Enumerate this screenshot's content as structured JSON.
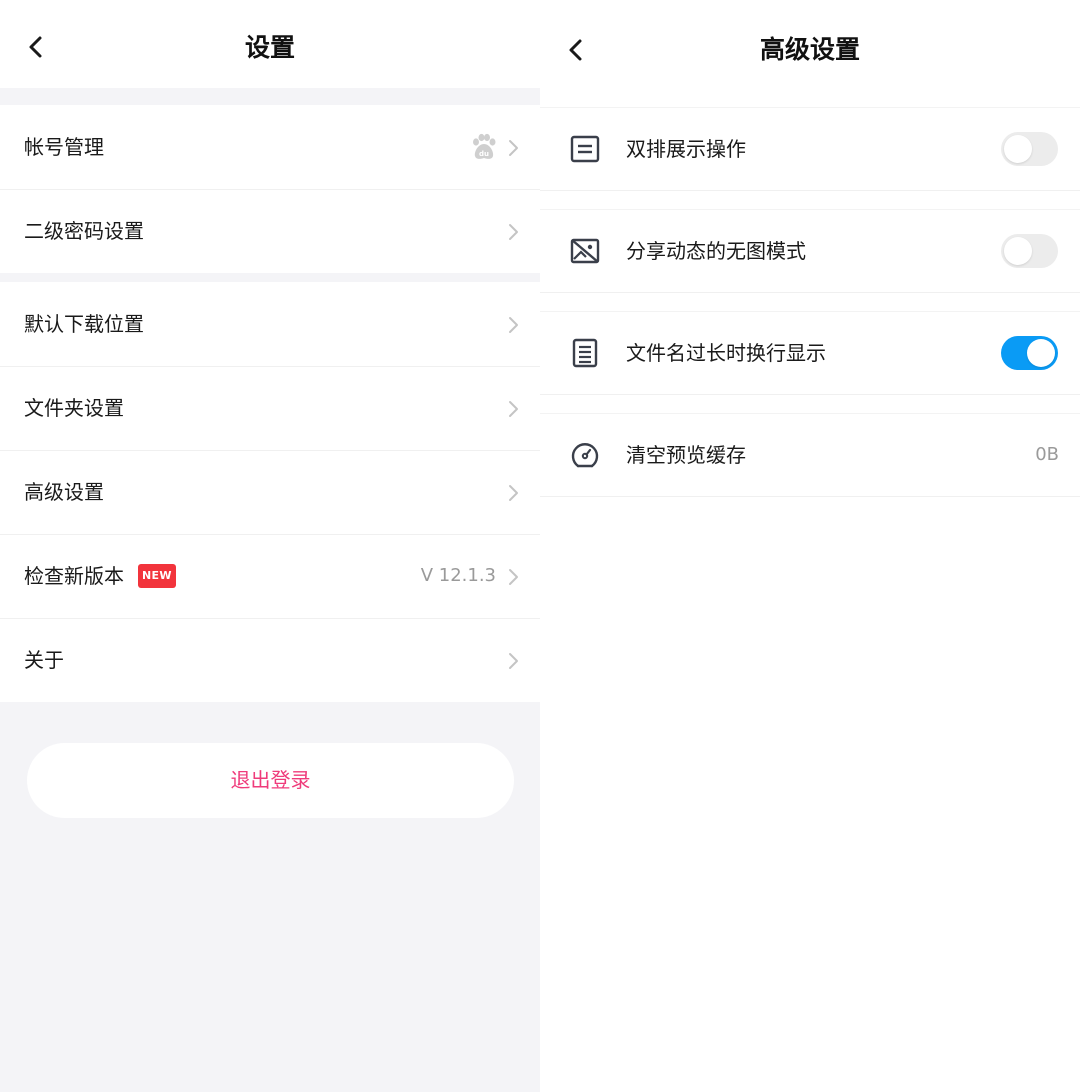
{
  "settings": {
    "title": "设置",
    "groups": [
      [
        {
          "label": "帐号管理",
          "icon": "baidu-paw-icon"
        },
        {
          "label": "二级密码设置"
        }
      ],
      [
        {
          "label": "默认下载位置"
        },
        {
          "label": "文件夹设置"
        },
        {
          "label": "高级设置"
        },
        {
          "label": "检查新版本",
          "badge": "NEW",
          "value": "V 12.1.3"
        },
        {
          "label": "关于"
        }
      ]
    ],
    "logout_label": "退出登录",
    "accent_color": "#ef3b7b",
    "badge_color": "#f2343c"
  },
  "advanced": {
    "title": "高级设置",
    "rows": [
      {
        "label": "双排展示操作",
        "icon": "list-icon",
        "toggle_on": false
      },
      {
        "label": "分享动态的无图模式",
        "icon": "no-image-icon",
        "toggle_on": false
      },
      {
        "label": "文件名过长时换行显示",
        "icon": "document-icon",
        "toggle_on": true
      },
      {
        "label": "清空预览缓存",
        "icon": "gauge-icon",
        "value": "0B"
      }
    ],
    "toggle_on_color": "#0a9bf5"
  }
}
